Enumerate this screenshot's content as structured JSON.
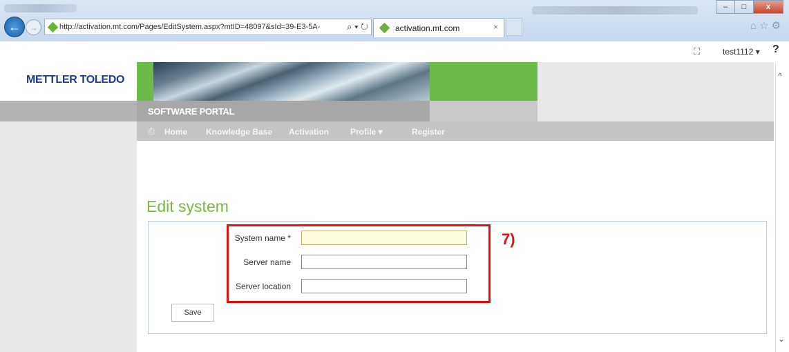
{
  "browser": {
    "url": "http://activation.mt.com/Pages/EditSystem.aspx?mtID=48097&sId=39-E3-5A-",
    "address_icons": "⌕ ▾ ↻",
    "tab_title": "activation.mt.com",
    "tab_close": "×",
    "back_icon": "←",
    "forward_icon": "→",
    "right_icons": "⌂☆⚙",
    "window_buttons": {
      "minimize": "–",
      "maximize": "□",
      "close": "x"
    }
  },
  "commandbar": {
    "user": "test1112 ▾",
    "help": "?",
    "screen_icon": "⛶"
  },
  "site": {
    "logo": "METTLER TOLEDO",
    "portal_title": "SOFTWARE PORTAL"
  },
  "nav": {
    "home_icon": "⎙",
    "items": [
      "Home",
      "Knowledge Base",
      "Activation",
      "Profile  ▾",
      "Register"
    ]
  },
  "form": {
    "heading": "Edit system",
    "fields": [
      {
        "label": "System name *",
        "value": ""
      },
      {
        "label": "Server name",
        "value": ""
      },
      {
        "label": "Server location",
        "value": ""
      }
    ],
    "save_label": "Save"
  },
  "annotation": {
    "label": "7)",
    "color": "#e01010"
  },
  "colors": {
    "accent_green": "#6cbb4a",
    "heading_green": "#7ab648",
    "logo_blue": "#1e3a8a"
  },
  "scroll": {
    "up": "^",
    "down": "⌄"
  }
}
